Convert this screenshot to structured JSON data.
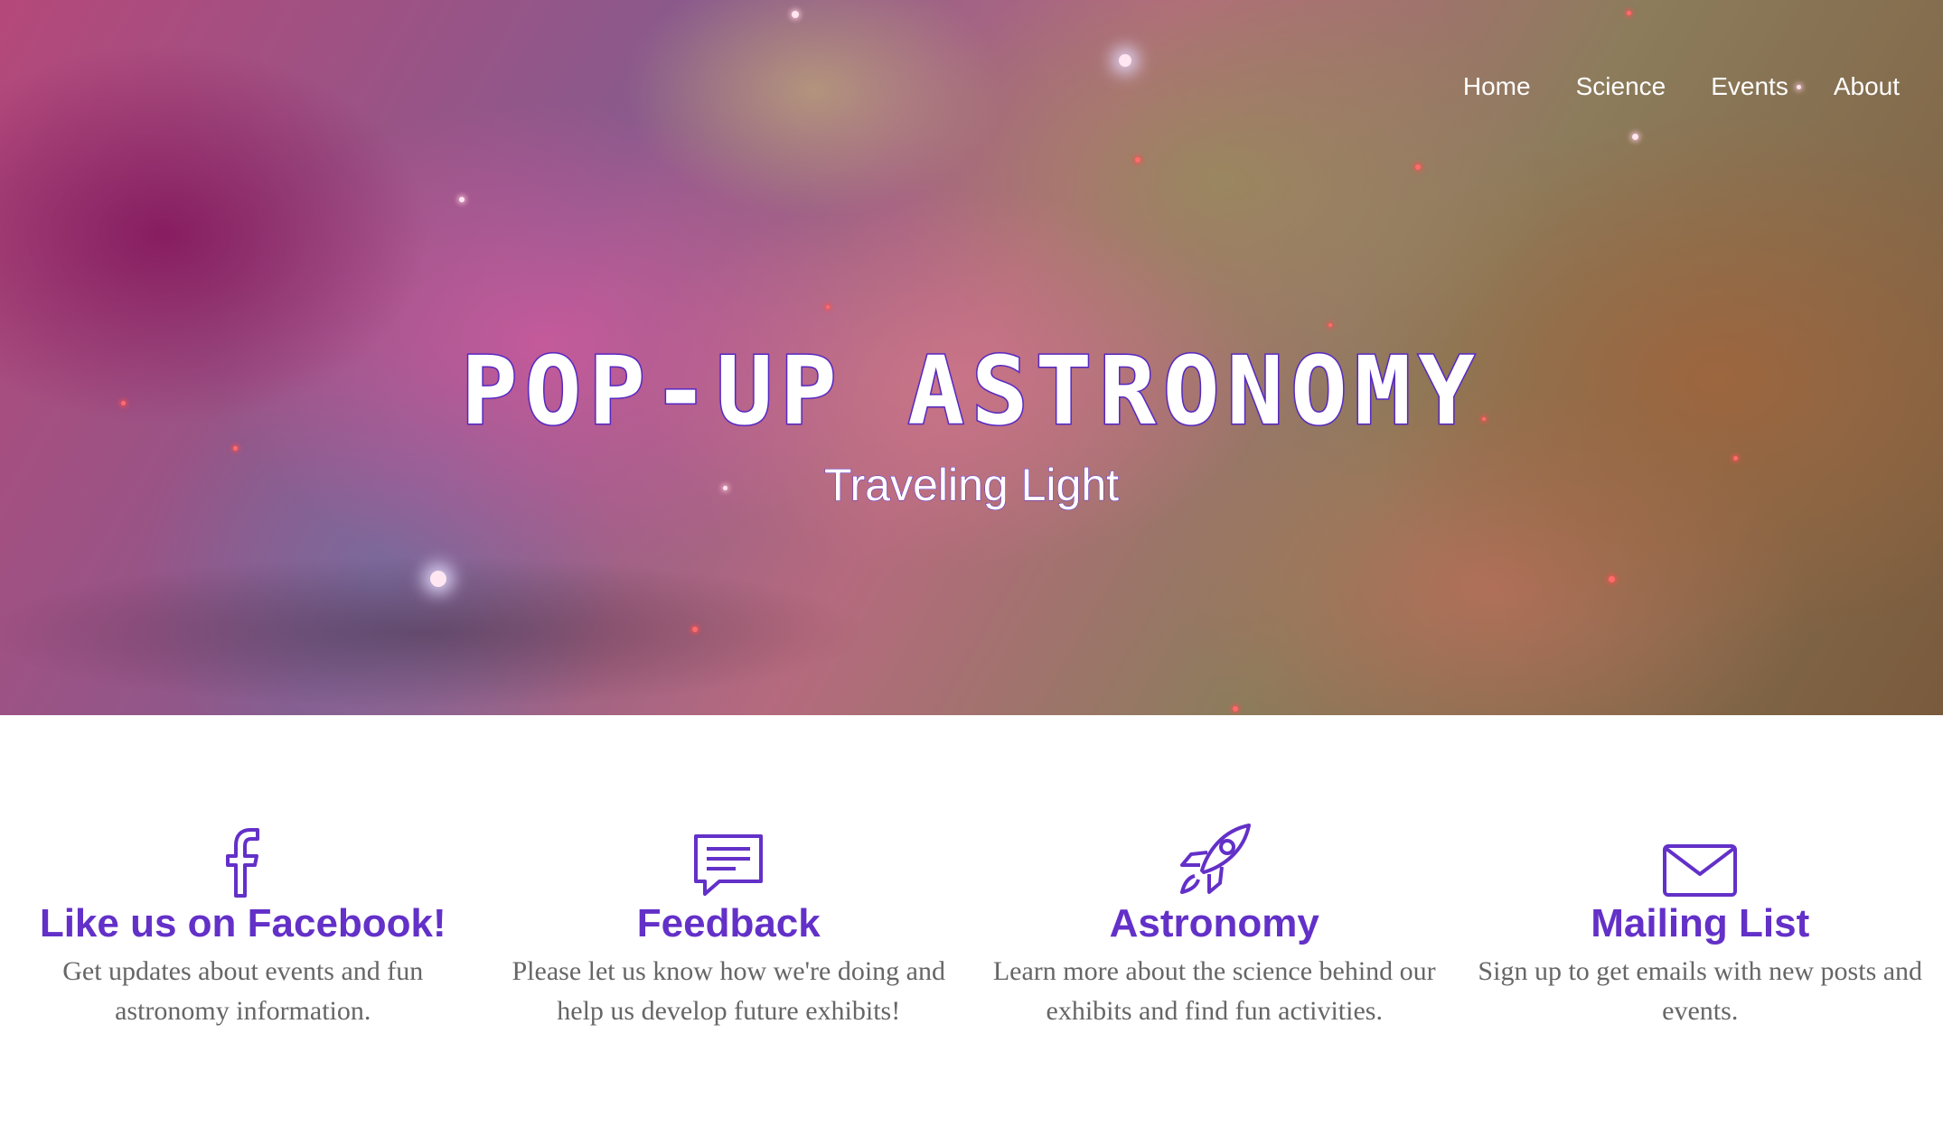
{
  "nav": {
    "items": [
      {
        "label": "Home"
      },
      {
        "label": "Science"
      },
      {
        "label": "Events"
      },
      {
        "label": "About"
      }
    ]
  },
  "hero": {
    "title": "POP-UP ASTRONOMY",
    "subtitle": "Traveling Light"
  },
  "features": [
    {
      "icon": "facebook-icon",
      "title": "Like us on Facebook!",
      "description": "Get updates about events and fun astronomy information."
    },
    {
      "icon": "comment-icon",
      "title": "Feedback",
      "description": "Please let us know how we're doing and help us develop future exhibits!"
    },
    {
      "icon": "rocket-icon",
      "title": "Astronomy",
      "description": "Learn more about the science behind our exhibits and find fun activities."
    },
    {
      "icon": "envelope-icon",
      "title": "Mailing List",
      "description": "Sign up to get emails with new posts and events."
    }
  ],
  "colors": {
    "accent": "#6330c8",
    "text_muted": "#666666",
    "nav_text": "#ffffff"
  }
}
